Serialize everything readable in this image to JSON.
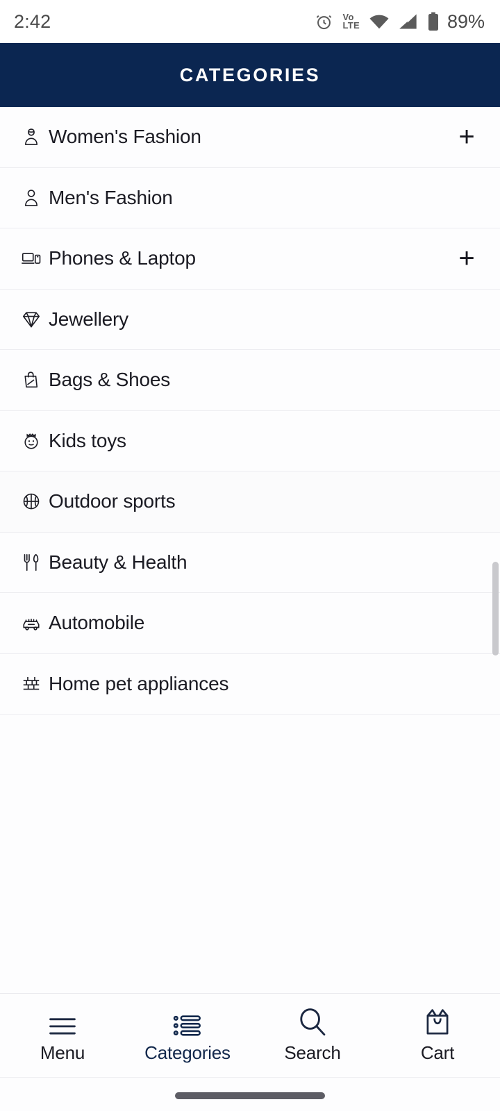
{
  "status_bar": {
    "time": "2:42",
    "alarm_icon": "alarm-clock-icon",
    "network_label_top": "Vo",
    "network_label_bottom": "LTE",
    "wifi_icon": "wifi-icon",
    "signal_icon": "cellular-signal-icon",
    "battery_icon": "battery-icon",
    "battery_percent": "89%"
  },
  "header": {
    "title": "CATEGORIES",
    "background_color": "#0b2651",
    "text_color": "#ffffff"
  },
  "categories": {
    "items": [
      {
        "label": "Women's Fashion",
        "icon": "woman-avatar-icon",
        "expandable": true,
        "expand_symbol": "+"
      },
      {
        "label": "Men's Fashion",
        "icon": "man-avatar-icon",
        "expandable": false,
        "expand_symbol": "+"
      },
      {
        "label": "Phones & Laptop",
        "icon": "laptop-phone-icon",
        "expandable": true,
        "expand_symbol": "+"
      },
      {
        "label": "Jewellery",
        "icon": "diamond-icon",
        "expandable": false,
        "expand_symbol": "+"
      },
      {
        "label": "Bags & Shoes",
        "icon": "shopping-bag-icon",
        "expandable": false,
        "expand_symbol": "+"
      },
      {
        "label": "Kids toys",
        "icon": "child-face-icon",
        "expandable": false,
        "expand_symbol": "+"
      },
      {
        "label": "Outdoor sports",
        "icon": "basketball-icon",
        "expandable": false,
        "expand_symbol": "+"
      },
      {
        "label": "Beauty & Health",
        "icon": "fork-knife-icon",
        "expandable": false,
        "expand_symbol": "+"
      },
      {
        "label": "Automobile",
        "icon": "car-icon",
        "expandable": false,
        "expand_symbol": "+"
      },
      {
        "label": "Home pet appliances",
        "icon": "shelf-icon",
        "expandable": false,
        "expand_symbol": "+"
      }
    ]
  },
  "scrollbar": {
    "visible": true
  },
  "bottom_nav": {
    "active_color": "#12284c",
    "items": [
      {
        "label": "Menu",
        "icon": "hamburger-menu-icon",
        "active": false
      },
      {
        "label": "Categories",
        "icon": "list-bullets-icon",
        "active": true
      },
      {
        "label": "Search",
        "icon": "search-icon",
        "active": false
      },
      {
        "label": "Cart",
        "icon": "shopping-cart-bag-icon",
        "active": false
      }
    ]
  },
  "system": {
    "home_indicator": "home-indicator"
  }
}
